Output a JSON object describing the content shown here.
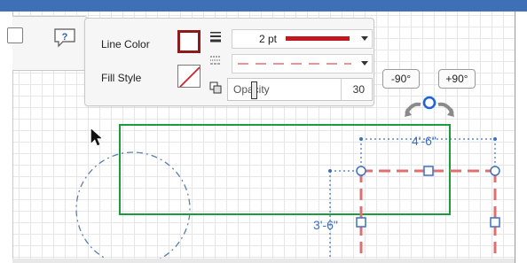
{
  "toolbar": {
    "line_color_label": "Line Color",
    "fill_style_label": "Fill Style",
    "line_weight_value": "2 pt",
    "opacity_label": "Opacity",
    "opacity_value": "30"
  },
  "rotate": {
    "ccw_label": "-90°",
    "cw_label": "+90°"
  },
  "dimensions": {
    "width_label": "4'-6\"",
    "height_label": "3'-6\""
  },
  "colors": {
    "title_bar": "#3f6fb6",
    "line_color": "#c0181e",
    "rectangle_stroke": "#1a9c3c",
    "dashed_red": "#e07070",
    "dimension_blue": "#3b70c4",
    "circle_stroke": "#5b7fb0"
  },
  "icons": {
    "help": "help-speech-bubble-icon",
    "rotate": "rotate-handle-icon",
    "cursor": "mouse-pointer-icon"
  }
}
